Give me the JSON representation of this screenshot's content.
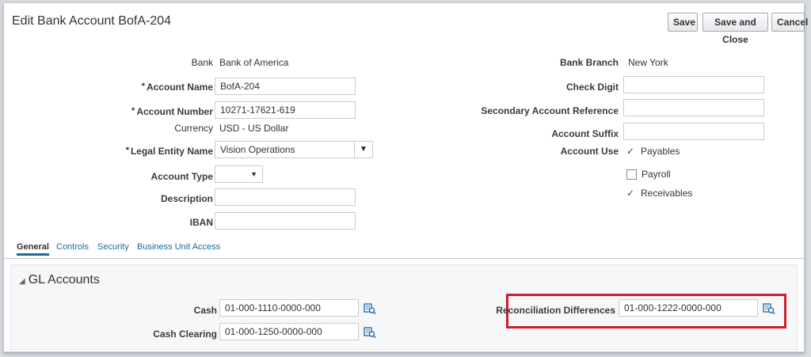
{
  "page": {
    "title": "Edit Bank Account BofA-204",
    "buttons": {
      "save": "Save",
      "save_close": "Save and Close",
      "cancel": "Cancel"
    }
  },
  "left_fields": {
    "bank": {
      "label": "Bank",
      "value": "Bank of America"
    },
    "account_name": {
      "label": "Account Name",
      "value": "BofA-204",
      "required": "*"
    },
    "account_number": {
      "label": "Account Number",
      "value": "10271-17621-619",
      "required": "*"
    },
    "currency": {
      "label": "Currency",
      "value": "USD - US Dollar"
    },
    "legal_entity": {
      "label": "Legal Entity Name",
      "value": "Vision Operations",
      "required": "*"
    },
    "account_type": {
      "label": "Account Type",
      "value": ""
    },
    "description": {
      "label": "Description",
      "value": ""
    },
    "iban": {
      "label": "IBAN",
      "value": ""
    }
  },
  "right_fields": {
    "bank_branch": {
      "label": "Bank Branch",
      "value": "New York"
    },
    "check_digit": {
      "label": "Check Digit",
      "value": ""
    },
    "secondary_ref": {
      "label": "Secondary Account Reference",
      "value": ""
    },
    "account_suffix": {
      "label": "Account Suffix",
      "value": ""
    },
    "account_use": {
      "label": "Account Use",
      "options": [
        {
          "label": "Payables",
          "checked": true
        },
        {
          "label": "Payroll",
          "checked": false
        },
        {
          "label": "Receivables",
          "checked": true
        }
      ]
    }
  },
  "tabs": [
    "General",
    "Controls",
    "Security",
    "Business Unit Access"
  ],
  "gl_accounts": {
    "title": "GL Accounts",
    "cash": {
      "label": "Cash",
      "value": "01-000-1110-0000-000"
    },
    "cash_clearing": {
      "label": "Cash Clearing",
      "value": "01-000-1250-0000-000"
    },
    "reconciliation": {
      "label": "Reconciliation Differences",
      "value": "01-000-1222-0000-000"
    }
  },
  "icons": {
    "lookup": "search-lookup-icon",
    "collapse": "triangle-down-icon",
    "select": "triangle-down-icon",
    "check": "checkmark-icon"
  },
  "colors": {
    "highlight": "#cc1f2a",
    "tab_accent": "#1c6a9e"
  }
}
